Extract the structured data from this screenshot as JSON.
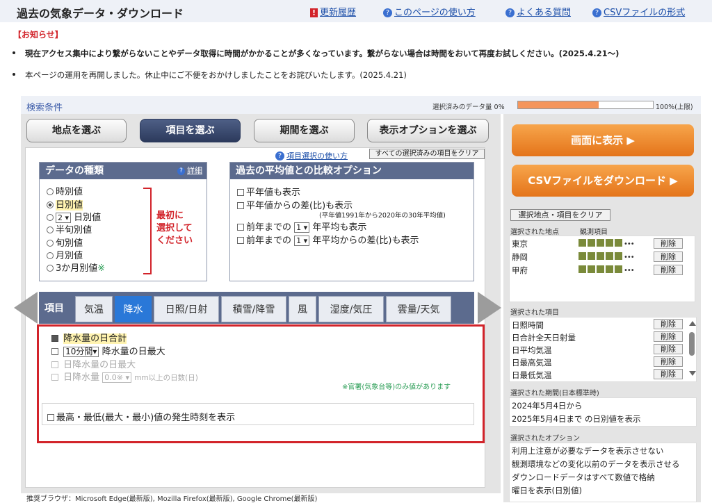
{
  "header": {
    "title": "過去の気象データ・ダウンロード",
    "links": [
      {
        "icon": "exclamation-icon",
        "label": "更新履歴"
      },
      {
        "icon": "question-icon",
        "label": "このページの使い方"
      },
      {
        "icon": "question-icon",
        "label": "よくある質問"
      },
      {
        "icon": "question-icon",
        "label": "CSVファイルの形式"
      }
    ]
  },
  "notice": {
    "heading": "【お知らせ】",
    "items": [
      "現在アクセス集中により繋がらないことやデータ取得に時間がかかることが多くなっています。繋がらない場合は時間をおいて再度お試しください。(2025.4.21〜)",
      "本ページの運用を再開しました。休止中にご不便をおかけしましたことをお詫びいたします。(2025.4.21)"
    ]
  },
  "search": {
    "heading": "検索条件",
    "data_amount_label": "選択済みのデータ量 0%",
    "data_amount_end": "100%(上限)",
    "data_amount_fraction": 0.6
  },
  "steps": [
    "地点を選ぶ",
    "項目を選ぶ",
    "期間を選ぶ",
    "表示オプションを選ぶ"
  ],
  "help": {
    "usage_link": "項目選択の使い方",
    "clear_all": "すべての選択済みの項目をクリア"
  },
  "data_type": {
    "heading": "データの種類",
    "detail": "詳細",
    "options": [
      "時別値",
      "日別値",
      "日別値",
      "半旬別値",
      "旬別値",
      "月別値",
      "3か月別値"
    ],
    "n_days_value": "2",
    "note": "最初に\n選択して\nください",
    "mark": "※"
  },
  "compare": {
    "heading": "過去の平均値との比較オプション",
    "opt1": "平年値も表示",
    "opt2": "平年値からの差(比)も表示",
    "opt2_note": "(平年値1991年から2020年の30年平均値)",
    "opt3_prefix": "前年までの",
    "opt3_value": "1",
    "opt3_suffix": "年平均も表示",
    "opt4_prefix": "前年までの",
    "opt4_value": "1",
    "opt4_suffix": "年平均からの差(比)も表示"
  },
  "tabs": {
    "label": "項目",
    "items": [
      "気温",
      "降水",
      "日照/日射",
      "積雪/降雪",
      "風",
      "湿度/気圧",
      "雲量/天気"
    ]
  },
  "precip": {
    "item1": "降水量の日合計",
    "item2_select": "10分間",
    "item2": "降水量の日最大",
    "item3": "日降水量の日最大",
    "item4_prefix": "日降水量",
    "item4_select": "0.0※",
    "item4_suffix": "mm以上の日数(日)",
    "note": "※官署(気象台等)のみ値があります",
    "maxmin": "最高・最低(最大・最小)値の発生時刻を表示"
  },
  "browsers": "推奨ブラウザ：Microsoft Edge(最新版), Mozilla Firefox(最新版), Google Chrome(最新版)",
  "sidebar": {
    "show_button": "画面に表示 ▶",
    "csv_button": "CSVファイルをダウンロード ▶",
    "clear_button": "選択地点・項目をクリア",
    "stations_label": "選択された地点",
    "elements_label": "観測項目",
    "stations": [
      "東京",
      "静岡",
      "甲府"
    ],
    "station_icons": "•••",
    "delete": "削除",
    "items_label": "選択された項目",
    "items": [
      "日照時間",
      "日合計全天日射量",
      "日平均気温",
      "日最高気温",
      "日最低気温"
    ],
    "period_label": "選択された期間(日本標準時)",
    "period_from": "2024年5月4日から",
    "period_to": "2025年5月4日まで の日別値を表示",
    "options_label": "選択されたオプション",
    "options": [
      "利用上注意が必要なデータを表示させない",
      "観測環境などの変化以前のデータを表示させる",
      "ダウンロードデータはすべて数値で格納",
      "曜日を表示(日別値)"
    ]
  }
}
